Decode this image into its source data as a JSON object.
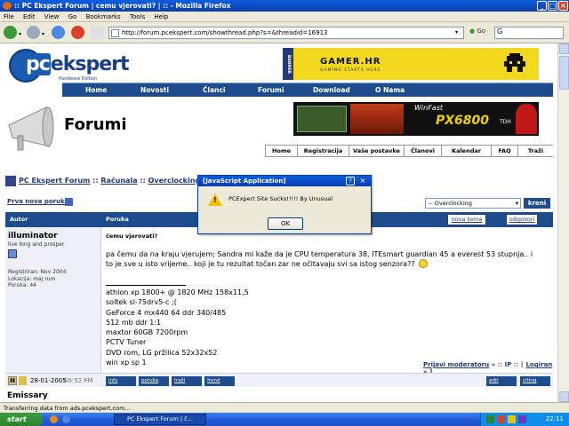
{
  "window": {
    "title": ":: PC Ekspert Forum | cemu vjerovati? | :: - Mozilla Firefox"
  },
  "menubar": [
    "File",
    "Edit",
    "View",
    "Go",
    "Bookmarks",
    "Tools",
    "Help"
  ],
  "navbar": {
    "url": "http://forum.pcekspert.com/showthread.php?s=&threadid=16913",
    "go_label": "Go",
    "search_value": "G"
  },
  "header": {
    "logo_text": "pcekspert",
    "logo_sub": "Hardware Edition",
    "banner_label": "BANNER",
    "banner_title": "GAMER.HR",
    "banner_sub": "GAMING STARTS HERE",
    "nav": [
      "Home",
      "Novosti",
      "Članci",
      "Forumi",
      "Download",
      "O Nama"
    ],
    "section_title": "Forumi",
    "ad2_win": "WinFast",
    "ad2_model": "PX6800",
    "ad2_suffix": "TDH",
    "menu": [
      "Home",
      "Registracija",
      "Vaše postavke",
      "Članovi",
      "Kalendar",
      "FAQ",
      "Traži"
    ]
  },
  "breadcrumb": {
    "root": "PC Ekspert Forum",
    "sep1": " :: ",
    "cat": "Računala",
    "sep2": " :: ",
    "sub": "Overclocking"
  },
  "thread": {
    "new_post_label": "Prva nova poruka",
    "jump_value": "-- Overclocking",
    "jump_button": "kreni",
    "col_author": "Autor",
    "col_post": "Poruka",
    "new_topic_button": "nova tema",
    "reply_button": "odgovori"
  },
  "post": {
    "author": "illuminator",
    "author_title": "live long and prosper",
    "info_lines": [
      "Registriran: Nov 2004",
      "Lokacija: maj rum",
      "Poruka: 44"
    ],
    "title": "čemu vjerovati?",
    "body_line1": "pa čemu da na kraju vjerujem; Sandra mi kaže da je CPU temperatura 38, ITEsmart guardian 45 a everest 53 stupnja.. i",
    "body_line2": "to je sve u isto vrijeme.. koji je tu rezultat točan zar ne očitavaju svi sa istog senzora??",
    "signature": [
      "athlon xp 1800+ @ 1820 MHz 158x11,5",
      "soltek sl-75drv5-c ;(",
      "GeForce 4 mx440 64 ddr 340/485",
      "512 mb ddr 1:1",
      "maxtor 60GB 7200rpm",
      "PCTV Tuner",
      "DVD rom, LG pržilica 52x32x52",
      "win xp sp 1"
    ],
    "mod_link": "Prijavi moderatoru",
    "ip_label": "IP",
    "log_link": "Logiran",
    "date": "28-01-2005",
    "time": "08:52 PM",
    "footer_buttons": [
      "info",
      "poruka",
      "traži",
      "frend"
    ],
    "edit_button": "edit",
    "quote_button": "citiraj"
  },
  "next_author": "Emissary",
  "status": "Transferring data from ads.pcekspert.com...",
  "taskbar": {
    "start": "start",
    "task": "PC Ekspert Forum | č...",
    "clock": "22:11"
  },
  "dialog": {
    "title": "[JavaScript Application]",
    "message": "PCExpert Site Sucks!!!!! By Unusual",
    "ok": "OK",
    "help_glyph": "?",
    "close_glyph": "×"
  },
  "colors": {
    "forum_blue": "#1e4d8e",
    "xp_title": "#0a49c4",
    "banner_yellow": "#f2d91e"
  }
}
